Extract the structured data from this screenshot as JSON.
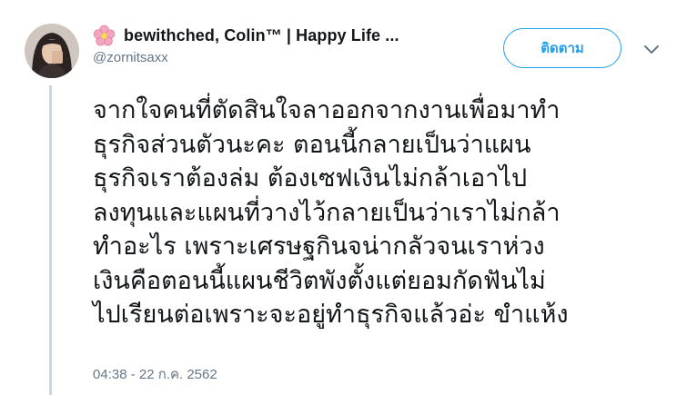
{
  "user": {
    "display_name": "bewithched, Colin™ | Happy Life ...",
    "handle": "@zornitsaxx",
    "name_emoji": "flower-icon",
    "avatar": "avatar"
  },
  "actions": {
    "follow_label": "ติดตาม",
    "more_menu_icon": "chevron-down-icon"
  },
  "tweet": {
    "lines": [
      "จากใจคนที่ตัดสินใจลาออกจากงานเพื่อมาทำ",
      "ธุรกิจส่วนตัวนะคะ ตอนนี้กลายเป็นว่าแผน",
      "ธุรกิจเราต้องล่ม ต้องเซฟเงินไม่กล้าเอาไป",
      "ลงทุนและแผนที่วางไว้กลายเป็นว่าเราไม่กล้า",
      "ทำอะไร เพราะเศรษฐกินจน่ากลัวจนเราห่วง",
      "เงินคือตอนนี้แผนชีวิตพังตั้งแต่ยอมกัดฟันไม่",
      "ไปเรียนต่อเพราะจะอยู่ทำธุรกิจแล้วอ่ะ ขำแห้ง"
    ],
    "timestamp": "04:38 - 22 ก.ค. 2562"
  },
  "colors": {
    "accent": "#1da1f2",
    "text_primary": "#14171a",
    "text_secondary": "#657786",
    "thread_line": "#ccd6dd"
  }
}
